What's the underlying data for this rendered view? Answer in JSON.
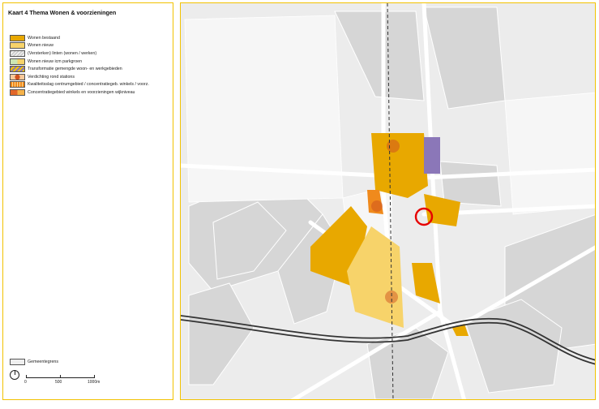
{
  "title": "Kaart 4 Thema Wonen & voorzieningen",
  "legend": [
    {
      "label": "Wonen bestaand",
      "color": "#e8a800",
      "pattern": "solid"
    },
    {
      "label": "Wonen nieuw",
      "color": "#f7d36a",
      "pattern": "solid"
    },
    {
      "label": "(Versterken) linten (wonen / werken)",
      "color": "#cfcfcf",
      "pattern": "hatch-gray"
    },
    {
      "label": "Wonen nieuw icm parkgroen",
      "color": "#cde6b4",
      "pattern": "green-yellow"
    },
    {
      "label": "Transformatie gemengde woon- en werkgebieden",
      "color": "#8b77b8",
      "pattern": "hatch-purple"
    },
    {
      "label": "Verdichting rond stations",
      "color": "#d0531f",
      "pattern": "dot"
    },
    {
      "label": "Kwaliteitsslag centrumgebied / concentratiegeb. winkels / voorz.",
      "color": "#f08a1c",
      "pattern": "stripes-orange"
    },
    {
      "label": "Concentratiegebied winkels en voorzieningen wijkniveau",
      "color": "#e2672a",
      "pattern": "orange-mix"
    }
  ],
  "footer": {
    "gemeentegrens": "Gemeentegrens",
    "scale_labels": [
      "0",
      "500",
      "1000m"
    ]
  },
  "map": {
    "colors": {
      "background": "#ececec",
      "built": "#d6d6d6",
      "road": "#ffffff",
      "rail": "#333333",
      "highlight": "#e60000"
    }
  }
}
